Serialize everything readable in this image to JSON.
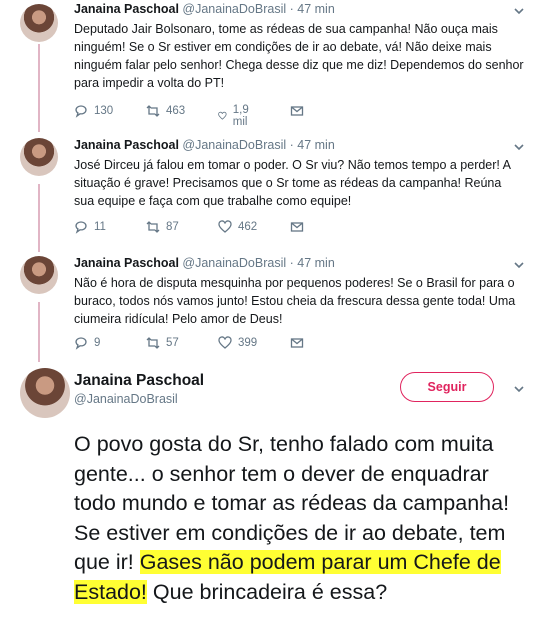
{
  "tweets": [
    {
      "name": "Janaina Paschoal",
      "handle": "@JanainaDoBrasil",
      "dot": "·",
      "time": "47 min",
      "text": "Deputado Jair Bolsonaro, tome as rédeas de sua campanha! Não ouça mais ninguém! Se o Sr estiver em condições de ir ao debate, vá! Não deixe mais ninguém falar pelo senhor! Chega desse diz que me diz! Dependemos do senhor para impedir a volta do PT!",
      "replies": "130",
      "retweets": "463",
      "likes": "1,9 mil"
    },
    {
      "name": "Janaina Paschoal",
      "handle": "@JanainaDoBrasil",
      "dot": "·",
      "time": "47 min",
      "text": "José Dirceu já falou em tomar o poder. O Sr viu? Não temos tempo a perder! A situação é grave! Precisamos que o Sr tome as rédeas da campanha! Reúna sua equipe e faça com que trabalhe como equipe!",
      "replies": "11",
      "retweets": "87",
      "likes": "462"
    },
    {
      "name": "Janaina Paschoal",
      "handle": "@JanainaDoBrasil",
      "dot": "·",
      "time": "47 min",
      "text": "Não é hora de disputa mesquinha por pequenos poderes! Se o Brasil for para o buraco, todos nós vamos junto! Estou cheia da frescura dessa gente toda! Uma ciumeira ridícula! Pelo amor de Deus!",
      "replies": "9",
      "retweets": "57",
      "likes": "399"
    }
  ],
  "main_tweet": {
    "name": "Janaina Paschoal",
    "handle": "@JanainaDoBrasil",
    "follow_label": "Seguir",
    "text_plain": "O povo gosta do Sr, tenho falado com muita gente... o senhor tem o dever de enquadrar todo mundo e tomar as rédeas da campanha! Se estiver em condições de ir ao debate, tem que ir! ",
    "text_highlight_1": "Gases não podem parar um Chefe de",
    "text_highlight_2": "Estado!",
    "text_tail": " Que brincadeira é essa?",
    "highlight_color": "#ffff33"
  },
  "colors": {
    "thread_line": "#e1b5c5",
    "follow_accent": "#e0245e",
    "secondary_text": "#657786"
  },
  "icons": {
    "reply": "reply-icon",
    "retweet": "retweet-icon",
    "like": "heart-icon",
    "dm": "envelope-icon",
    "menu": "chevron-down-icon"
  }
}
